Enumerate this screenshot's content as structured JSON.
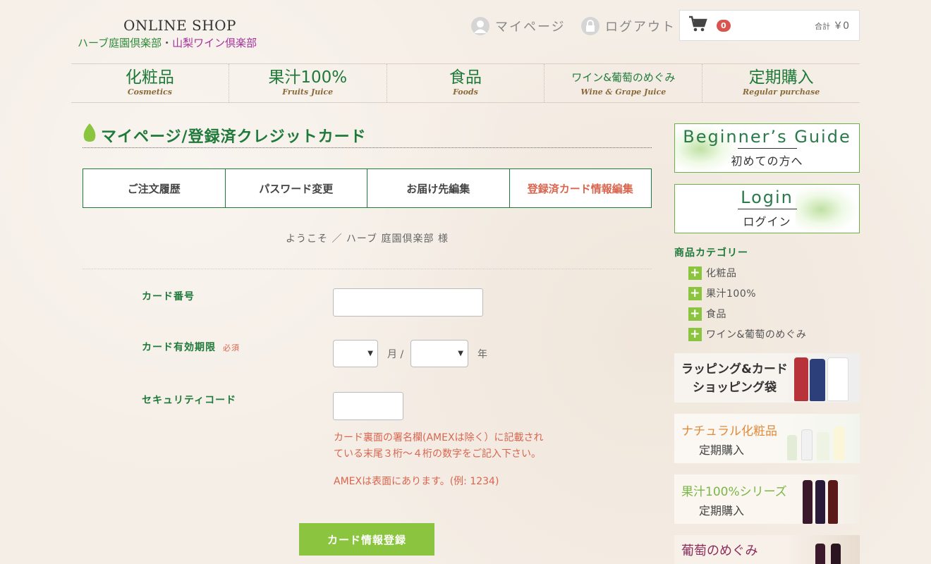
{
  "header": {
    "logo_top": "ONLINE SHOP",
    "logo_herb": "ハーブ庭園倶楽部",
    "logo_dot": "・",
    "logo_wine": "山梨ワイン倶楽部",
    "mypage": "マイページ",
    "logout": "ログアウト",
    "cart_count": "0",
    "cart_total_label": "合計",
    "cart_total": "￥0"
  },
  "nav": [
    {
      "jp": "化粧品",
      "en": "Cosmetics"
    },
    {
      "jp": "果汁100%",
      "en": "Fruits Juice"
    },
    {
      "jp": "食品",
      "en": "Foods"
    },
    {
      "jp": "ワイン&葡萄のめぐみ",
      "en": "Wine & Grape Juice"
    },
    {
      "jp": "定期購入",
      "en": "Regular purchase"
    }
  ],
  "main": {
    "title": "マイページ/登録済クレジットカード",
    "tabs": [
      "ご注文履歴",
      "パスワード変更",
      "お届け先編集",
      "登録済カード情報編集"
    ],
    "welcome": "ようこそ ／ ハーブ 庭園倶楽部 様",
    "form": {
      "card_number_label": "カード番号",
      "expiry_label": "カード有効期限",
      "required": "必須",
      "month_unit": "月 /",
      "year_unit": "年",
      "security_label": "セキュリティコード",
      "note1_line1": "カード裏面の署名欄(AMEXは除く）に記載され",
      "note1_line2": "ている末尾３桁～４桁の数字をご記入下さい。",
      "note2": "AMEXは表面にあります。(例: 1234)",
      "submit": "カード情報登録"
    }
  },
  "sidebar": {
    "guide_en": "Beginner’s Guide",
    "guide_jp": "初めての方へ",
    "login_en": "Login",
    "login_jp": "ログイン",
    "cat_title": "商品カテゴリー",
    "categories": [
      "化粧品",
      "果汁100%",
      "食品",
      "ワイン&葡萄のめぐみ"
    ],
    "promo1_l1": "ラッピング&カード",
    "promo1_l2": "ショッピング袋",
    "promo2_l1": "ナチュラル化粧品",
    "promo2_l2": "定期購入",
    "promo3_l1": "果汁100%シリーズ",
    "promo3_l2": "定期購入",
    "promo4_l1": "葡萄のめぐみ"
  },
  "colors": {
    "brand_green": "#1f7a3a",
    "accent_orange": "#d9654f",
    "button_green": "#8bc53f"
  }
}
